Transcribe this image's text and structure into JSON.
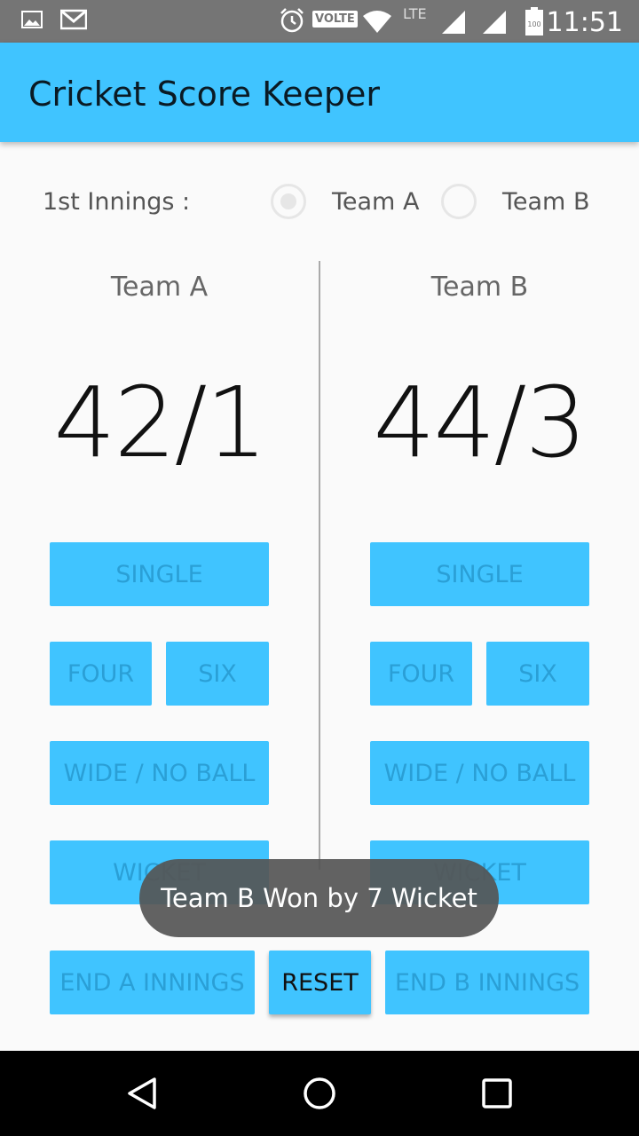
{
  "status_bar": {
    "time": "11:51",
    "volte": "VOLTE",
    "lte": "LTE",
    "battery": "100",
    "icons": [
      "image-icon",
      "gmail-icon",
      "alarm-icon",
      "volte-icon",
      "wifi-icon",
      "lte-icon",
      "signal-icon",
      "signal-icon",
      "battery-icon"
    ]
  },
  "app_bar": {
    "title": "Cricket Score Keeper"
  },
  "innings": {
    "label": "1st Innings :",
    "options": [
      {
        "label": "Team A",
        "checked": true
      },
      {
        "label": "Team B",
        "checked": false
      }
    ]
  },
  "teams": [
    {
      "name": "Team A",
      "score": "42/1",
      "buttons": {
        "single": "SINGLE",
        "four": "FOUR",
        "six": "SIX",
        "wide": "WIDE / NO BALL",
        "wicket": "WICKET"
      }
    },
    {
      "name": "Team B",
      "score": "44/3",
      "buttons": {
        "single": "SINGLE",
        "four": "FOUR",
        "six": "SIX",
        "wide": "WIDE / NO BALL",
        "wicket": "WICKET"
      }
    }
  ],
  "bottom": {
    "end_a": "END A INNINGS",
    "reset": "RESET",
    "end_b": "END B INNINGS"
  },
  "toast": "Team B Won by 7 Wicket",
  "colors": {
    "accent": "#40c4ff",
    "disabled_text": "#2a9fd6",
    "status_bar": "#757575"
  },
  "nav": [
    "back-icon",
    "home-icon",
    "recents-icon"
  ]
}
